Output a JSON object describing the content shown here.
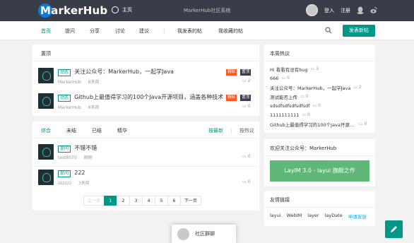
{
  "header": {
    "logo_text": "MarkerHub",
    "home_label": "主页",
    "notice": "MarkerHub社区系统",
    "login": "登入",
    "register": "注册"
  },
  "nav": {
    "items": [
      "首页",
      "提问",
      "分享",
      "讨论",
      "建议",
      "我发表的帖",
      "我收藏的帖"
    ],
    "publish_button": "发表新帖"
  },
  "top_posts": {
    "title": "置顶",
    "items": [
      {
        "tag": "动态",
        "title": "关注公众号：MarkerHub，一起学Java",
        "author": "MarkerHub",
        "time": "6天前",
        "badges": [
          "精帖",
          "置顶"
        ],
        "comments": "2"
      },
      {
        "tag": "动态",
        "title": "Github上最值得学习的100个Java开源项目，涵盖各种技术...",
        "author": "MarkerHub",
        "time": "6天前",
        "badges": [
          "精帖",
          "置顶"
        ],
        "comments": "0"
      }
    ]
  },
  "feed": {
    "tabs": [
      "综合",
      "未结",
      "已结",
      "精华"
    ],
    "sort": [
      "按最新",
      "按热议"
    ],
    "items": [
      {
        "tag": "提问",
        "title": "不错不错",
        "author": "test8070",
        "time": "刚刚",
        "comments": "0"
      },
      {
        "tag": "提问",
        "title": "222",
        "author": "zzzzzz",
        "time": "3天前",
        "comments": "0"
      }
    ]
  },
  "pagination": {
    "prev": "上一页",
    "pages": [
      "1",
      "2",
      "3",
      "4",
      "5",
      "6"
    ],
    "current": "1",
    "next": "下一页"
  },
  "weekly_hot": {
    "title": "本周热议",
    "items": [
      {
        "title": "Hi 看看有没有bug",
        "count": "3"
      },
      {
        "title": "666",
        "count": "0"
      },
      {
        "title": "关注公众号：MarkerHub，一起学Java",
        "count": "2"
      },
      {
        "title": "测试能否上传",
        "count": "0"
      },
      {
        "title": "sdsdfsdfsdfsdfsdf",
        "count": "0"
      },
      {
        "title": "1111111111",
        "count": "0"
      },
      {
        "title": "Github上最值得学习的100个Java开源项目",
        "count": "0"
      }
    ]
  },
  "ad": {
    "title": "欢迎关注公众号：MarkerHub",
    "button": "LayIM 3.0 - layui 旗舰之作"
  },
  "friend_links": {
    "title": "友情链接",
    "items": [
      "layui",
      "WebIM",
      "layer",
      "layDate"
    ],
    "apply": "申请友链"
  },
  "chat": {
    "label": "社区群聊"
  },
  "colors": {
    "topbar": "#393d49",
    "accent": "#009688",
    "hot": "#ff5722",
    "ad_green": "#5fb878"
  }
}
